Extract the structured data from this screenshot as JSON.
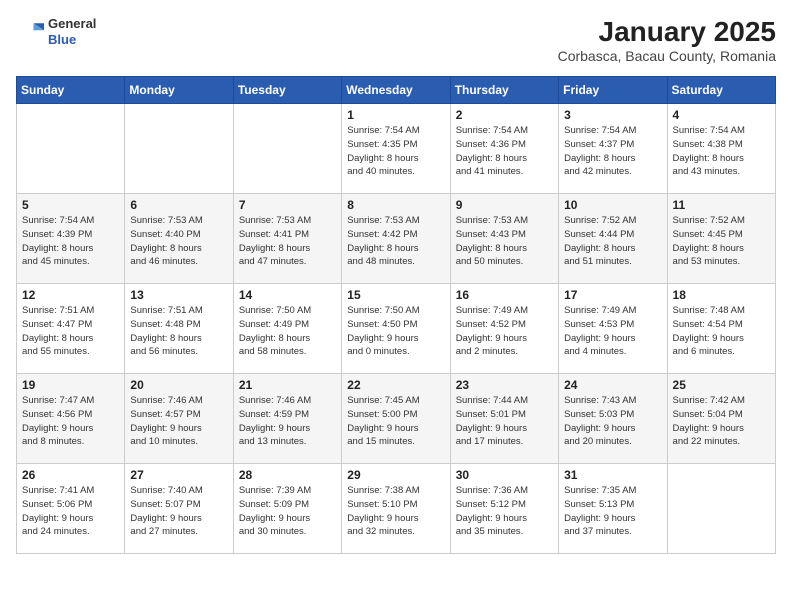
{
  "logo": {
    "general": "General",
    "blue": "Blue"
  },
  "title": "January 2025",
  "subtitle": "Corbasca, Bacau County, Romania",
  "weekdays": [
    "Sunday",
    "Monday",
    "Tuesday",
    "Wednesday",
    "Thursday",
    "Friday",
    "Saturday"
  ],
  "weeks": [
    [
      {
        "day": "",
        "info": ""
      },
      {
        "day": "",
        "info": ""
      },
      {
        "day": "",
        "info": ""
      },
      {
        "day": "1",
        "info": "Sunrise: 7:54 AM\nSunset: 4:35 PM\nDaylight: 8 hours\nand 40 minutes."
      },
      {
        "day": "2",
        "info": "Sunrise: 7:54 AM\nSunset: 4:36 PM\nDaylight: 8 hours\nand 41 minutes."
      },
      {
        "day": "3",
        "info": "Sunrise: 7:54 AM\nSunset: 4:37 PM\nDaylight: 8 hours\nand 42 minutes."
      },
      {
        "day": "4",
        "info": "Sunrise: 7:54 AM\nSunset: 4:38 PM\nDaylight: 8 hours\nand 43 minutes."
      }
    ],
    [
      {
        "day": "5",
        "info": "Sunrise: 7:54 AM\nSunset: 4:39 PM\nDaylight: 8 hours\nand 45 minutes."
      },
      {
        "day": "6",
        "info": "Sunrise: 7:53 AM\nSunset: 4:40 PM\nDaylight: 8 hours\nand 46 minutes."
      },
      {
        "day": "7",
        "info": "Sunrise: 7:53 AM\nSunset: 4:41 PM\nDaylight: 8 hours\nand 47 minutes."
      },
      {
        "day": "8",
        "info": "Sunrise: 7:53 AM\nSunset: 4:42 PM\nDaylight: 8 hours\nand 48 minutes."
      },
      {
        "day": "9",
        "info": "Sunrise: 7:53 AM\nSunset: 4:43 PM\nDaylight: 8 hours\nand 50 minutes."
      },
      {
        "day": "10",
        "info": "Sunrise: 7:52 AM\nSunset: 4:44 PM\nDaylight: 8 hours\nand 51 minutes."
      },
      {
        "day": "11",
        "info": "Sunrise: 7:52 AM\nSunset: 4:45 PM\nDaylight: 8 hours\nand 53 minutes."
      }
    ],
    [
      {
        "day": "12",
        "info": "Sunrise: 7:51 AM\nSunset: 4:47 PM\nDaylight: 8 hours\nand 55 minutes."
      },
      {
        "day": "13",
        "info": "Sunrise: 7:51 AM\nSunset: 4:48 PM\nDaylight: 8 hours\nand 56 minutes."
      },
      {
        "day": "14",
        "info": "Sunrise: 7:50 AM\nSunset: 4:49 PM\nDaylight: 8 hours\nand 58 minutes."
      },
      {
        "day": "15",
        "info": "Sunrise: 7:50 AM\nSunset: 4:50 PM\nDaylight: 9 hours\nand 0 minutes."
      },
      {
        "day": "16",
        "info": "Sunrise: 7:49 AM\nSunset: 4:52 PM\nDaylight: 9 hours\nand 2 minutes."
      },
      {
        "day": "17",
        "info": "Sunrise: 7:49 AM\nSunset: 4:53 PM\nDaylight: 9 hours\nand 4 minutes."
      },
      {
        "day": "18",
        "info": "Sunrise: 7:48 AM\nSunset: 4:54 PM\nDaylight: 9 hours\nand 6 minutes."
      }
    ],
    [
      {
        "day": "19",
        "info": "Sunrise: 7:47 AM\nSunset: 4:56 PM\nDaylight: 9 hours\nand 8 minutes."
      },
      {
        "day": "20",
        "info": "Sunrise: 7:46 AM\nSunset: 4:57 PM\nDaylight: 9 hours\nand 10 minutes."
      },
      {
        "day": "21",
        "info": "Sunrise: 7:46 AM\nSunset: 4:59 PM\nDaylight: 9 hours\nand 13 minutes."
      },
      {
        "day": "22",
        "info": "Sunrise: 7:45 AM\nSunset: 5:00 PM\nDaylight: 9 hours\nand 15 minutes."
      },
      {
        "day": "23",
        "info": "Sunrise: 7:44 AM\nSunset: 5:01 PM\nDaylight: 9 hours\nand 17 minutes."
      },
      {
        "day": "24",
        "info": "Sunrise: 7:43 AM\nSunset: 5:03 PM\nDaylight: 9 hours\nand 20 minutes."
      },
      {
        "day": "25",
        "info": "Sunrise: 7:42 AM\nSunset: 5:04 PM\nDaylight: 9 hours\nand 22 minutes."
      }
    ],
    [
      {
        "day": "26",
        "info": "Sunrise: 7:41 AM\nSunset: 5:06 PM\nDaylight: 9 hours\nand 24 minutes."
      },
      {
        "day": "27",
        "info": "Sunrise: 7:40 AM\nSunset: 5:07 PM\nDaylight: 9 hours\nand 27 minutes."
      },
      {
        "day": "28",
        "info": "Sunrise: 7:39 AM\nSunset: 5:09 PM\nDaylight: 9 hours\nand 30 minutes."
      },
      {
        "day": "29",
        "info": "Sunrise: 7:38 AM\nSunset: 5:10 PM\nDaylight: 9 hours\nand 32 minutes."
      },
      {
        "day": "30",
        "info": "Sunrise: 7:36 AM\nSunset: 5:12 PM\nDaylight: 9 hours\nand 35 minutes."
      },
      {
        "day": "31",
        "info": "Sunrise: 7:35 AM\nSunset: 5:13 PM\nDaylight: 9 hours\nand 37 minutes."
      },
      {
        "day": "",
        "info": ""
      }
    ]
  ]
}
